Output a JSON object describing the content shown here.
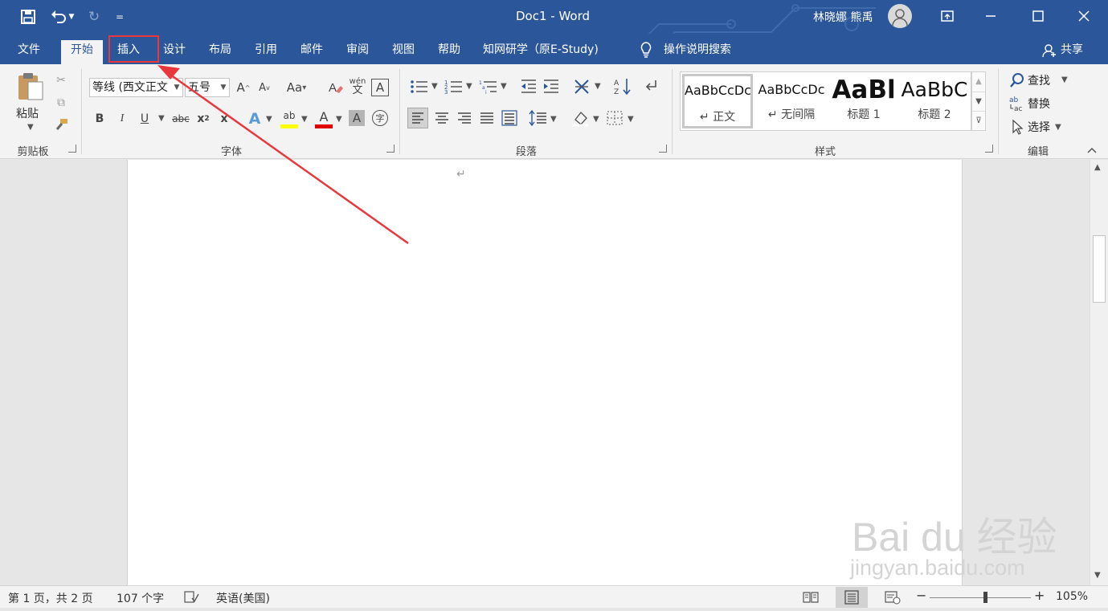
{
  "titlebar": {
    "title": "Doc1  -  Word",
    "user": "林晓娜 熊禹",
    "qat_more": "="
  },
  "tabs": [
    {
      "label": "文件"
    },
    {
      "label": "开始"
    },
    {
      "label": "插入"
    },
    {
      "label": "设计"
    },
    {
      "label": "布局"
    },
    {
      "label": "引用"
    },
    {
      "label": "邮件"
    },
    {
      "label": "审阅"
    },
    {
      "label": "视图"
    },
    {
      "label": "帮助"
    },
    {
      "label": "知网研学（原E-Study)"
    }
  ],
  "tell_me": "操作说明搜索",
  "share": "共享",
  "clipboard": {
    "paste": "粘贴",
    "label": "剪贴板"
  },
  "font": {
    "name": "等线 (西文正文",
    "size": "五号",
    "grow": "A",
    "shrink": "A",
    "case": "Aa",
    "phonetic": "wén",
    "phonetic2": "文",
    "border_char": "A",
    "bold": "B",
    "italic": "I",
    "underline": "U",
    "strike": "abc",
    "subscript": "x",
    "superscript": "x",
    "effects": "A",
    "highlight": "ab",
    "color": "A",
    "shading": "A",
    "enclose": "字",
    "label": "字体"
  },
  "paragraph": {
    "label": "段落"
  },
  "styles": {
    "label": "样式",
    "items": [
      {
        "sample": "AaBbCcDc",
        "name": "↵ 正文"
      },
      {
        "sample": "AaBbCcDc",
        "name": "↵ 无间隔"
      },
      {
        "sample": "AaBl",
        "name": "标题 1"
      },
      {
        "sample": "AaBbC",
        "name": "标题 2"
      }
    ]
  },
  "editing": {
    "find": "查找",
    "replace": "替换",
    "select": "选择",
    "label": "编辑"
  },
  "document": {
    "para_mark": "↵"
  },
  "status": {
    "page": "第 1 页，共 2 页",
    "words": "107 个字",
    "language": "英语(美国)",
    "zoom": "105%",
    "zoom_minus": "−",
    "zoom_plus": "+",
    "zoom_level": 0.55
  },
  "watermark": {
    "brand": "Bai du 经验",
    "url": "jingyan.baidu.com"
  },
  "colors": {
    "accent": "#2b579a",
    "annotation": "#e8383d",
    "highlight_bar": "#ffff00",
    "font_color_bar": "#e00000"
  }
}
